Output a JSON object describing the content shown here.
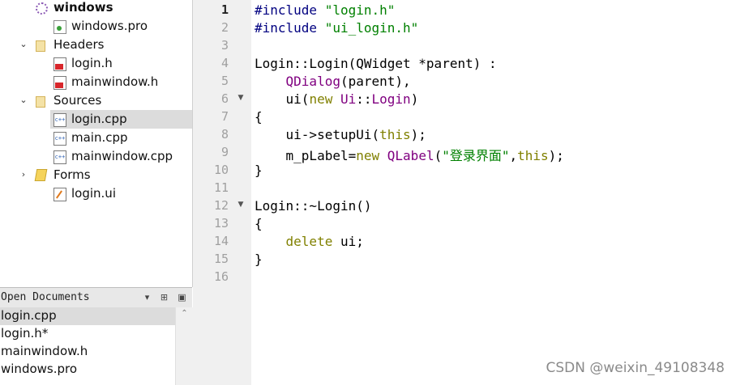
{
  "project_tree": {
    "project": "windows",
    "items": [
      {
        "label": "windows",
        "icon": "qt-project-icon",
        "depth": 0,
        "arrow": "",
        "bold": true
      },
      {
        "label": "windows.pro",
        "icon": "pro-file-icon",
        "depth": 1,
        "arrow": ""
      },
      {
        "label": "Headers",
        "icon": "folder-headers-icon",
        "depth": 0,
        "arrow": "v"
      },
      {
        "label": "login.h",
        "icon": "header-file-icon",
        "depth": 1,
        "arrow": ""
      },
      {
        "label": "mainwindow.h",
        "icon": "header-file-icon",
        "depth": 1,
        "arrow": ""
      },
      {
        "label": "Sources",
        "icon": "folder-sources-icon",
        "depth": 0,
        "arrow": "v"
      },
      {
        "label": "login.cpp",
        "icon": "cpp-file-icon",
        "depth": 1,
        "arrow": "",
        "selected": true
      },
      {
        "label": "main.cpp",
        "icon": "cpp-file-icon",
        "depth": 1,
        "arrow": ""
      },
      {
        "label": "mainwindow.cpp",
        "icon": "cpp-file-icon",
        "depth": 1,
        "arrow": ""
      },
      {
        "label": "Forms",
        "icon": "forms-folder-icon",
        "depth": 0,
        "arrow": ">"
      },
      {
        "label": "login.ui",
        "icon": "ui-file-icon",
        "depth": 1,
        "arrow": ""
      }
    ]
  },
  "open_documents": {
    "title": "Open Documents",
    "buttons": [
      "▾",
      "⊞",
      "▣"
    ],
    "items": [
      {
        "label": "login.cpp",
        "selected": true
      },
      {
        "label": "login.h*"
      },
      {
        "label": "mainwindow.h"
      },
      {
        "label": "windows.pro"
      }
    ]
  },
  "editor": {
    "current_line": 1,
    "lines": [
      {
        "n": "1",
        "tokens": [
          {
            "t": "#include ",
            "c": "pp"
          },
          {
            "t": "\"login.h\"",
            "c": "str"
          }
        ]
      },
      {
        "n": "2",
        "tokens": [
          {
            "t": "#include ",
            "c": "pp"
          },
          {
            "t": "\"ui_login.h\"",
            "c": "str"
          }
        ]
      },
      {
        "n": "3",
        "tokens": []
      },
      {
        "n": "4",
        "tokens": [
          {
            "t": "Login::Login(QWidget *parent) :",
            "c": ""
          }
        ]
      },
      {
        "n": "5",
        "tokens": [
          {
            "t": "    ",
            "c": ""
          },
          {
            "t": "QDialog",
            "c": "cls"
          },
          {
            "t": "(parent),",
            "c": ""
          }
        ]
      },
      {
        "n": "6",
        "tokens": [
          {
            "t": "    ui(",
            "c": ""
          },
          {
            "t": "new",
            "c": "kw"
          },
          {
            "t": " ",
            "c": ""
          },
          {
            "t": "Ui",
            "c": "cls"
          },
          {
            "t": "::",
            "c": ""
          },
          {
            "t": "Login",
            "c": "cls"
          },
          {
            "t": ")",
            "c": ""
          }
        ],
        "fold": true
      },
      {
        "n": "7",
        "tokens": [
          {
            "t": "{",
            "c": ""
          }
        ]
      },
      {
        "n": "8",
        "tokens": [
          {
            "t": "    ui->setupUi(",
            "c": ""
          },
          {
            "t": "this",
            "c": "kw"
          },
          {
            "t": ");",
            "c": ""
          }
        ]
      },
      {
        "n": "9",
        "tokens": [
          {
            "t": "    m_pLabel=",
            "c": ""
          },
          {
            "t": "new",
            "c": "kw"
          },
          {
            "t": " ",
            "c": ""
          },
          {
            "t": "QLabel",
            "c": "cls"
          },
          {
            "t": "(",
            "c": ""
          },
          {
            "t": "\"登录界面\"",
            "c": "str"
          },
          {
            "t": ",",
            "c": ""
          },
          {
            "t": "this",
            "c": "kw"
          },
          {
            "t": ");",
            "c": ""
          }
        ]
      },
      {
        "n": "10",
        "tokens": [
          {
            "t": "}",
            "c": ""
          }
        ]
      },
      {
        "n": "11",
        "tokens": []
      },
      {
        "n": "12",
        "tokens": [
          {
            "t": "Login::~Login()",
            "c": ""
          }
        ],
        "fold": true
      },
      {
        "n": "13",
        "tokens": [
          {
            "t": "{",
            "c": ""
          }
        ]
      },
      {
        "n": "14",
        "tokens": [
          {
            "t": "    ",
            "c": ""
          },
          {
            "t": "delete",
            "c": "kw"
          },
          {
            "t": " ui;",
            "c": ""
          }
        ]
      },
      {
        "n": "15",
        "tokens": [
          {
            "t": "}",
            "c": ""
          }
        ]
      },
      {
        "n": "16",
        "tokens": []
      }
    ]
  },
  "watermark": "CSDN @weixin_49108348"
}
